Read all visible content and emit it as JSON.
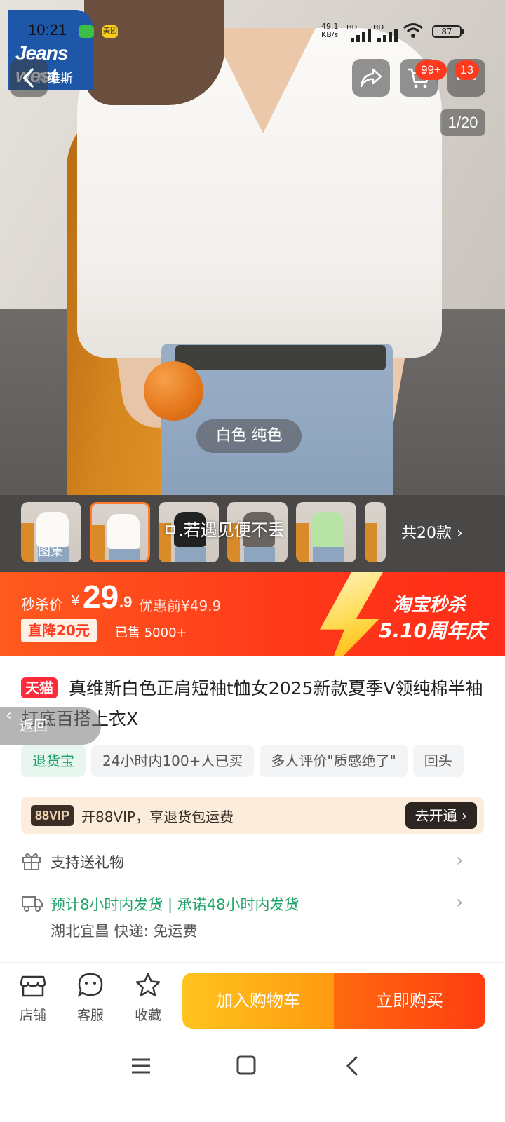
{
  "status_bar": {
    "time": "10:21",
    "meituan": "美团",
    "net_speed": "49.1",
    "net_unit": "KB/s",
    "sim1": "HD",
    "sim2": "HD",
    "battery": "87"
  },
  "brand_logo": {
    "line1": "Jeans west",
    "line2": "真维斯"
  },
  "header": {
    "cart_badge": "99+",
    "more_badge": "13",
    "image_counter": "1/20"
  },
  "hero": {
    "variant_label": "白色 纯色"
  },
  "thumbnails": {
    "gallery_label": "图集",
    "overlay_text": "ㅁ.若遇见便不丢",
    "total_label": "共20款"
  },
  "flash_sale": {
    "label": "秒杀价",
    "currency": "¥",
    "price_int": "29",
    "price_dec": ".9",
    "before_price": "优惠前¥49.9",
    "drop_label": "直降20元",
    "sold": "已售 5000+",
    "event_line1": "淘宝秒杀",
    "event_line2": "5.10周年庆"
  },
  "product": {
    "store_badge": "天猫",
    "title": "真维斯白色正肩短袖t恤女2025新款夏季V领纯棉半袖打底百搭上衣X",
    "tags": [
      "退货宝",
      "24小时内100+人已买",
      "多人评价\"质感绝了\"",
      "回头"
    ]
  },
  "floating_back": "返回",
  "vip": {
    "badge": "88VIP",
    "text": "开88VIP，享退货包运费",
    "button": "去开通"
  },
  "services": {
    "gift": "支持送礼物",
    "shipping": "预计8小时内发货 | 承诺48小时内发货",
    "shipping_sub": "湖北宜昌  快递:  免运费"
  },
  "action_bar": {
    "store": "店铺",
    "service": "客服",
    "favorite": "收藏",
    "add_cart": "加入购物车",
    "buy_now": "立即购买"
  },
  "colors": {
    "accent": "#ff3a1a",
    "cart": "#ffb012",
    "green": "#1ea469"
  }
}
